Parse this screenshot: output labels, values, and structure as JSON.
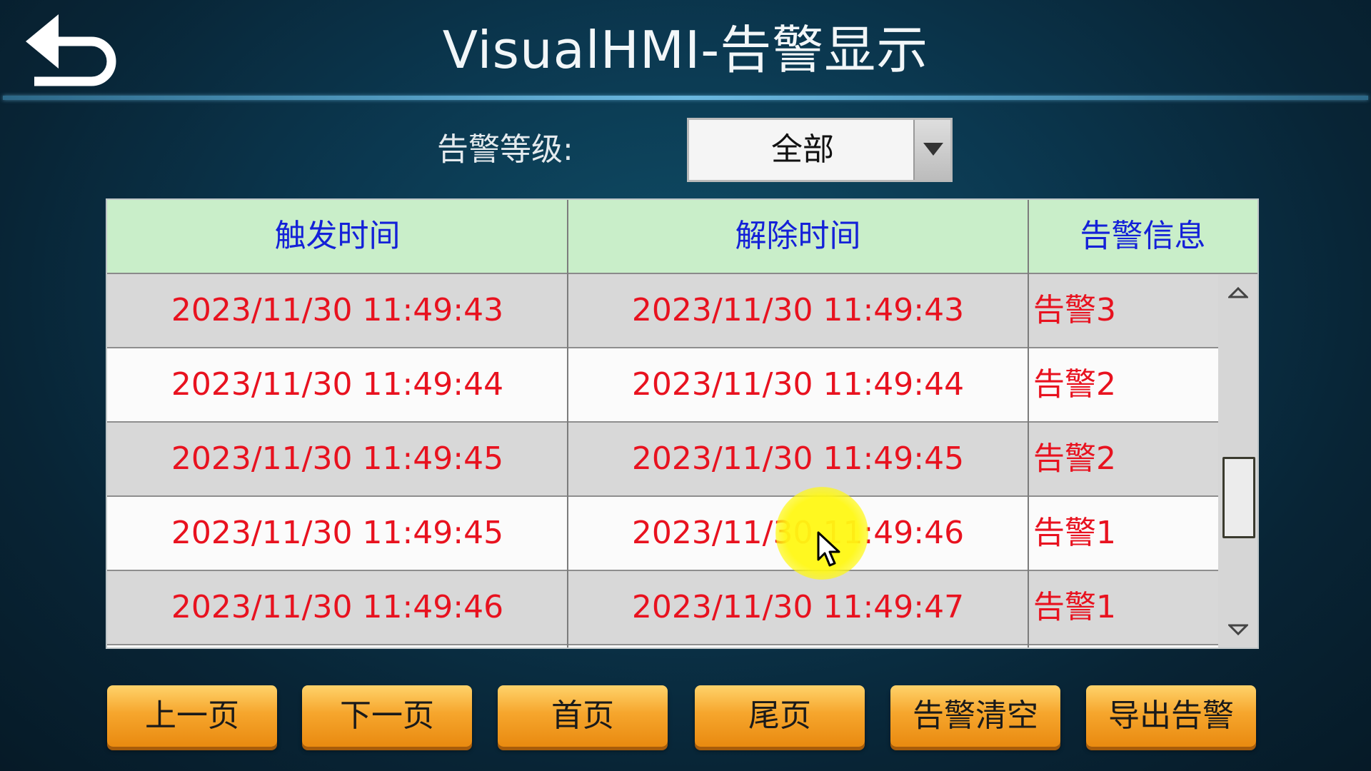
{
  "header": {
    "title": "VisualHMI-告警显示",
    "back_icon": "back-arrow-icon"
  },
  "filter": {
    "label": "告警等级:",
    "selected": "全部"
  },
  "table": {
    "columns": [
      "触发时间",
      "解除时间",
      "告警信息"
    ],
    "rows": [
      {
        "trigger": "2023/11/30 11:49:43",
        "clear": "2023/11/30 11:49:43",
        "info": "告警3"
      },
      {
        "trigger": "2023/11/30 11:49:44",
        "clear": "2023/11/30 11:49:44",
        "info": "告警2"
      },
      {
        "trigger": "2023/11/30 11:49:45",
        "clear": "2023/11/30 11:49:45",
        "info": "告警2"
      },
      {
        "trigger": "2023/11/30 11:49:45",
        "clear": "2023/11/30 11:49:46",
        "info": "告警1"
      },
      {
        "trigger": "2023/11/30 11:49:46",
        "clear": "2023/11/30 11:49:47",
        "info": "告警1"
      }
    ]
  },
  "buttons": {
    "prev_page": "上一页",
    "next_page": "下一页",
    "first_page": "首页",
    "last_page": "尾页",
    "clear_alarms": "告警清空",
    "export_alarms": "导出告警"
  },
  "colors": {
    "header_row": "#c9eec9",
    "header_text": "#1421d8",
    "cell_text": "#e8121f",
    "button": "#f6a62d"
  }
}
